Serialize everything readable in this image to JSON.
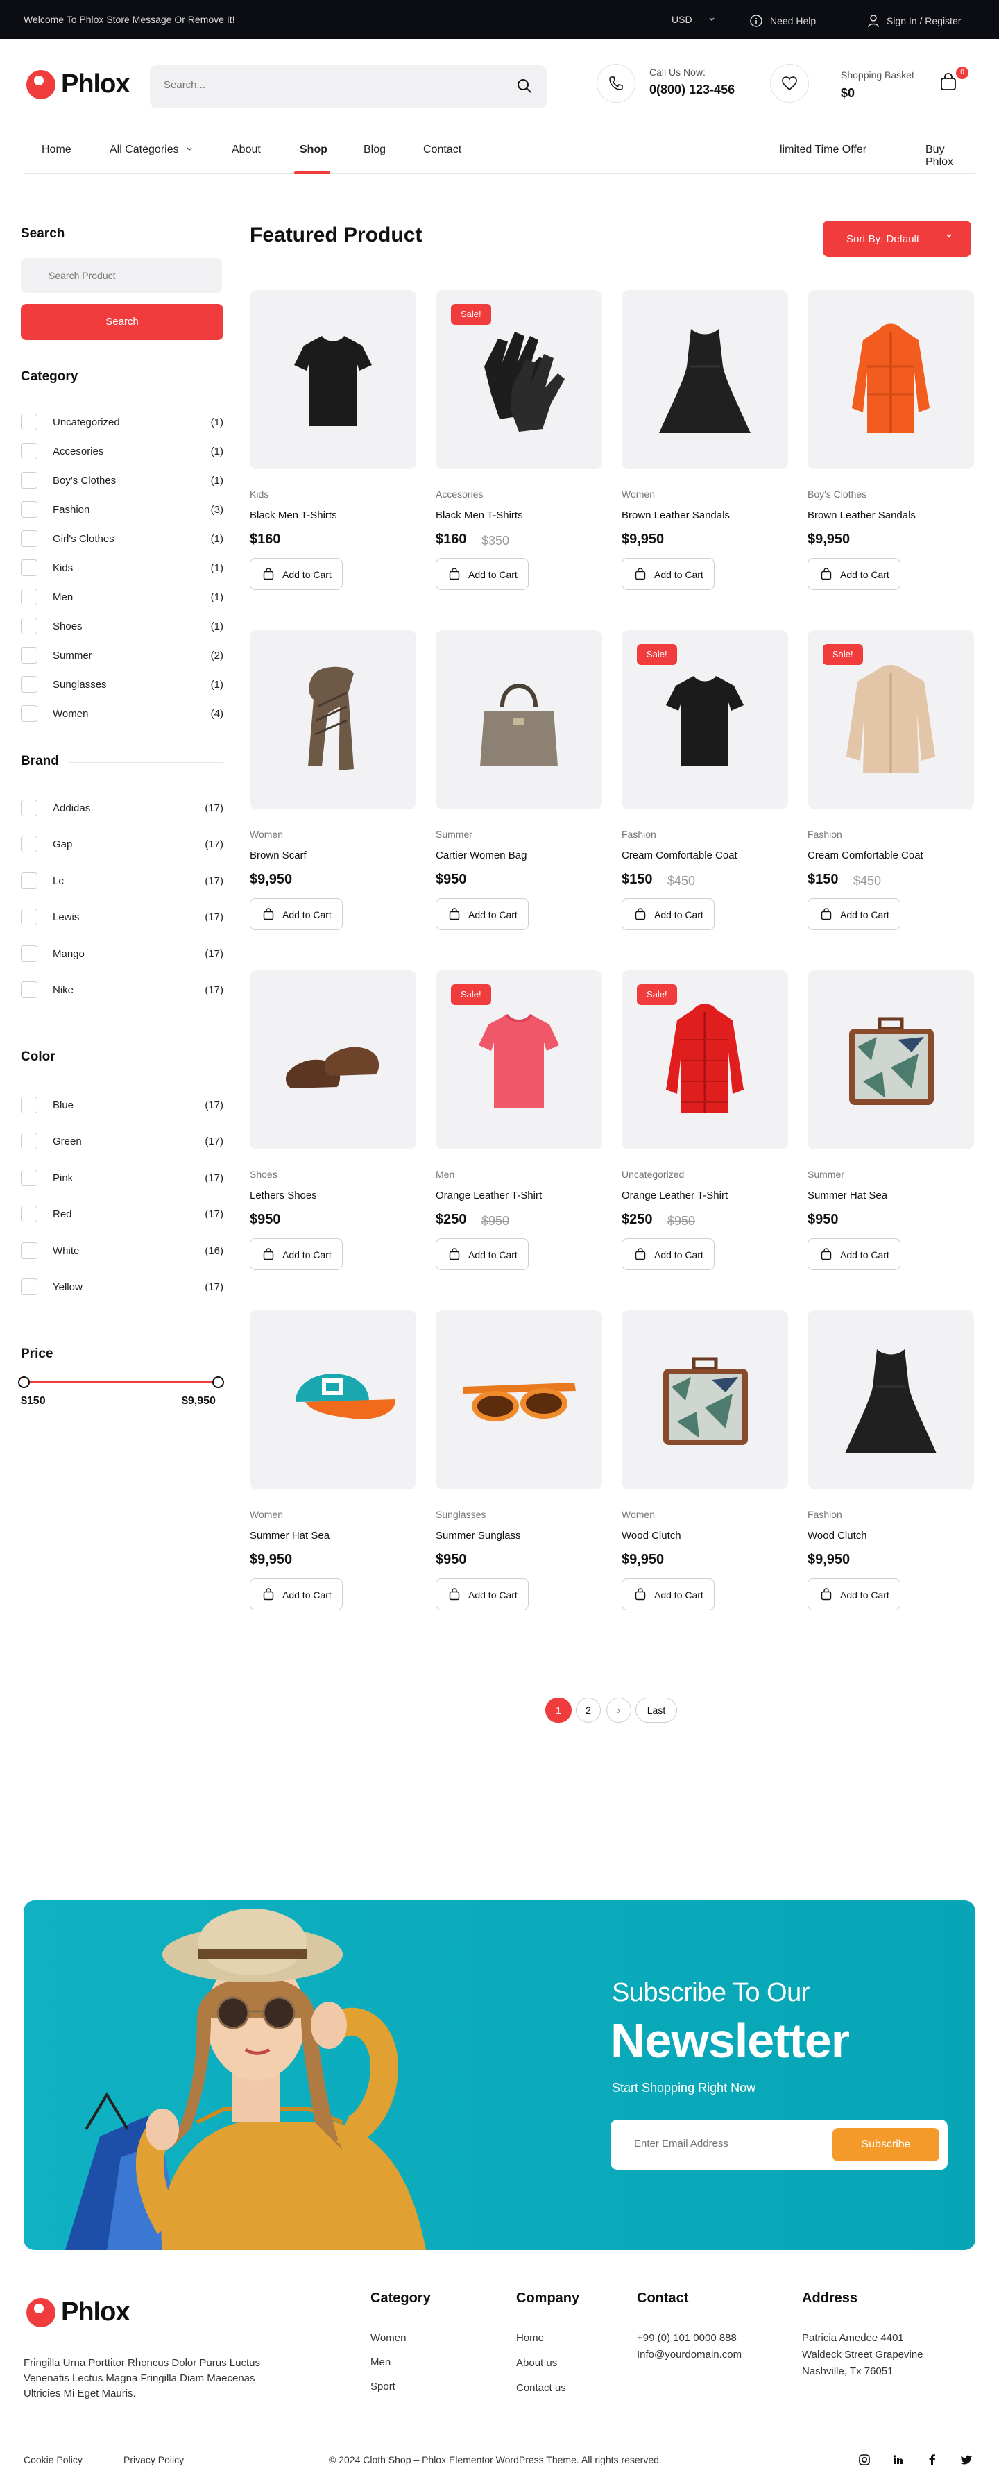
{
  "topbar": {
    "message": "Welcome To Phlox Store Message Or Remove It!",
    "currency": "USD",
    "help": "Need Help",
    "signin": "Sign In / Register"
  },
  "brand": {
    "name": "Phlox",
    "color": "#f03c3c"
  },
  "search": {
    "placeholder": "Search..."
  },
  "header": {
    "call_label": "Call Us Now:",
    "phone": "0(800) 123-456",
    "basket_label": "Shopping Basket",
    "basket_total": "$0",
    "cart_count": "0"
  },
  "nav": {
    "items": [
      "Home",
      "All Categories",
      "About",
      "Shop",
      "Blog",
      "Contact"
    ],
    "active": "Shop",
    "right": [
      "limited Time Offer",
      "Buy Phlox"
    ]
  },
  "sidebar": {
    "search_title": "Search",
    "search_placeholder": "Search Product",
    "search_button": "Search",
    "category_title": "Category",
    "categories": [
      {
        "label": "Uncategorized",
        "count": "(1)"
      },
      {
        "label": "Accesories",
        "count": "(1)"
      },
      {
        "label": "Boy's Clothes",
        "count": "(1)"
      },
      {
        "label": "Fashion",
        "count": "(3)"
      },
      {
        "label": "Girl's Clothes",
        "count": "(1)"
      },
      {
        "label": "Kids",
        "count": "(1)"
      },
      {
        "label": "Men",
        "count": "(1)"
      },
      {
        "label": "Shoes",
        "count": "(1)"
      },
      {
        "label": "Summer",
        "count": "(2)"
      },
      {
        "label": "Sunglasses",
        "count": "(1)"
      },
      {
        "label": "Women",
        "count": "(4)"
      }
    ],
    "brand_title": "Brand",
    "brands": [
      {
        "label": "Addidas",
        "count": "(17)"
      },
      {
        "label": "Gap",
        "count": "(17)"
      },
      {
        "label": "Lc",
        "count": "(17)"
      },
      {
        "label": "Lewis",
        "count": "(17)"
      },
      {
        "label": "Mango",
        "count": "(17)"
      },
      {
        "label": "Nike",
        "count": "(17)"
      }
    ],
    "color_title": "Color",
    "colors": [
      {
        "label": "Blue",
        "count": "(17)"
      },
      {
        "label": "Green",
        "count": "(17)"
      },
      {
        "label": "Pink",
        "count": "(17)"
      },
      {
        "label": "Red",
        "count": "(17)"
      },
      {
        "label": "White",
        "count": "(16)"
      },
      {
        "label": "Yellow",
        "count": "(17)"
      }
    ],
    "price_title": "Price",
    "price_min": "$150",
    "price_max": "$9,950"
  },
  "featured": {
    "title": "Featured Product",
    "sort_label": "Sort By: Default",
    "add_to_cart": "Add to Cart",
    "sale_label": "Sale!",
    "products": [
      {
        "category": "Kids",
        "name": "Black Men T-Shirts",
        "price": "$160",
        "old": "",
        "sale": false,
        "icon": "tshirt-black"
      },
      {
        "category": "Accesories",
        "name": "Black Men T-Shirts",
        "price": "$160",
        "old": "$350",
        "sale": true,
        "icon": "gloves"
      },
      {
        "category": "Women",
        "name": "Brown Leather Sandals",
        "price": "$9,950",
        "old": "",
        "sale": false,
        "icon": "dress-black"
      },
      {
        "category": "Boy's Clothes",
        "name": "Brown Leather Sandals",
        "price": "$9,950",
        "old": "",
        "sale": false,
        "icon": "jacket-orange"
      },
      {
        "category": "Women",
        "name": "Brown Scarf",
        "price": "$9,950",
        "old": "",
        "sale": false,
        "icon": "scarf"
      },
      {
        "category": "Summer",
        "name": "Cartier Women Bag",
        "price": "$950",
        "old": "",
        "sale": false,
        "icon": "handbag"
      },
      {
        "category": "Fashion",
        "name": "Cream Comfortable Coat",
        "price": "$150",
        "old": "$450",
        "sale": true,
        "icon": "tshirt-black"
      },
      {
        "category": "Fashion",
        "name": "Cream Comfortable Coat",
        "price": "$150",
        "old": "$450",
        "sale": true,
        "icon": "fur-coat"
      },
      {
        "category": "Shoes",
        "name": "Lethers Shoes",
        "price": "$950",
        "old": "",
        "sale": false,
        "icon": "shoes"
      },
      {
        "category": "Men",
        "name": "Orange Leather T-Shirt",
        "price": "$250",
        "old": "$950",
        "sale": true,
        "icon": "tshirt-pink"
      },
      {
        "category": "Uncategorized",
        "name": "Orange Leather T-Shirt",
        "price": "$250",
        "old": "$950",
        "sale": true,
        "icon": "jacket-red"
      },
      {
        "category": "Summer",
        "name": "Summer Hat Sea",
        "price": "$950",
        "old": "",
        "sale": false,
        "icon": "suitcase"
      },
      {
        "category": "Women",
        "name": "Summer Hat Sea",
        "price": "$9,950",
        "old": "",
        "sale": false,
        "icon": "cap"
      },
      {
        "category": "Sunglasses",
        "name": "Summer Sunglass",
        "price": "$950",
        "old": "",
        "sale": false,
        "icon": "sunglasses"
      },
      {
        "category": "Women",
        "name": "Wood Clutch",
        "price": "$9,950",
        "old": "",
        "sale": false,
        "icon": "suitcase"
      },
      {
        "category": "Fashion",
        "name": "Wood Clutch",
        "price": "$9,950",
        "old": "",
        "sale": false,
        "icon": "dress-black"
      }
    ]
  },
  "pagination": {
    "pages": [
      "1",
      "2"
    ],
    "next": "›",
    "last": "Last",
    "active": "1"
  },
  "newsletter": {
    "line1": "Subscribe To Our",
    "line2": "Newsletter",
    "line3": "Start Shopping Right Now",
    "placeholder": "Enter Email Address",
    "button": "Subscribe",
    "bg": "#0fb1c2",
    "button_color": "#f39a2b"
  },
  "footer": {
    "description": "Fringilla Urna Porttitor Rhoncus Dolor Purus Luctus Venenatis Lectus Magna Fringilla Diam Maecenas Ultricies Mi Eget Mauris.",
    "category_title": "Category",
    "category_links": [
      "Women",
      "Men",
      "Sport"
    ],
    "company_title": "Company",
    "company_links": [
      "Home",
      "About us",
      "Contact us"
    ],
    "contact_title": "Contact",
    "contact_lines": [
      "+99 (0) 101 0000 888",
      "Info@yourdomain.com"
    ],
    "address_title": "Address",
    "address_lines": [
      "Patricia Amedee 4401",
      "Waldeck Street Grapevine",
      "Nashville, Tx 76051"
    ],
    "cookie": "Cookie Policy",
    "privacy": "Privacy Policy",
    "copyright": "© 2024 Cloth Shop – Phlox Elementor WordPress Theme. All rights reserved.",
    "social": [
      "instagram-icon",
      "linkedin-icon",
      "facebook-icon",
      "twitter-icon"
    ]
  }
}
